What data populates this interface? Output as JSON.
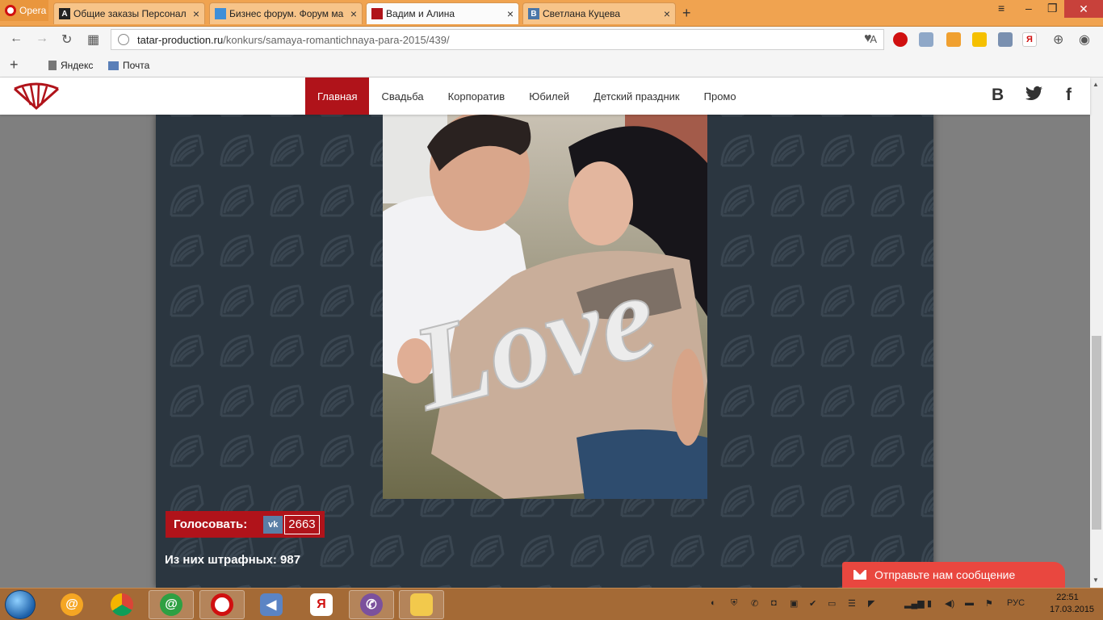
{
  "browser": {
    "menu_label": "Opera",
    "tabs": [
      {
        "label": "Общие заказы Персонал",
        "favicon": "A",
        "active": false
      },
      {
        "label": "Бизнес форум. Форум ма",
        "favicon": "",
        "active": false
      },
      {
        "label": "Вадим и Алина",
        "favicon": "",
        "active": true
      },
      {
        "label": "Светлана Куцева",
        "favicon": "B",
        "active": false
      }
    ],
    "url_domain": "tatar-production.ru",
    "url_path": "/konkurs/samaya-romantichnaya-para-2015/439/",
    "url_translate_label": "A",
    "bookmarks": [
      {
        "label": "Яндекс"
      },
      {
        "label": "Почта"
      }
    ],
    "extension_labels": {
      "yandex_ext": "Я"
    }
  },
  "site": {
    "menu": [
      {
        "label": "Главная",
        "active": true
      },
      {
        "label": "Свадьба",
        "active": false
      },
      {
        "label": "Корпоратив",
        "active": false
      },
      {
        "label": "Юбилей",
        "active": false
      },
      {
        "label": "Детский праздник",
        "active": false
      },
      {
        "label": "Промо",
        "active": false
      }
    ],
    "social": {
      "vk": "В",
      "twitter": "twitter-icon",
      "facebook": "f"
    },
    "photo_caption": "Love"
  },
  "vote": {
    "label": "Голосовать:",
    "vk_logo": "vk",
    "count": "2663",
    "penalty_text": "Из них штрафных: 987"
  },
  "message_widget": {
    "label": "Отправьте нам сообщение"
  },
  "taskbar": {
    "yandex_label": "Я",
    "lang": "РУС",
    "time": "22:51",
    "date": "17.03.2015"
  },
  "colors": {
    "accent": "#b0131a",
    "content_bg": "#2b3640",
    "tabbar": "#f0a350",
    "taskbar": "#a46a36",
    "message": "#e9473f"
  }
}
